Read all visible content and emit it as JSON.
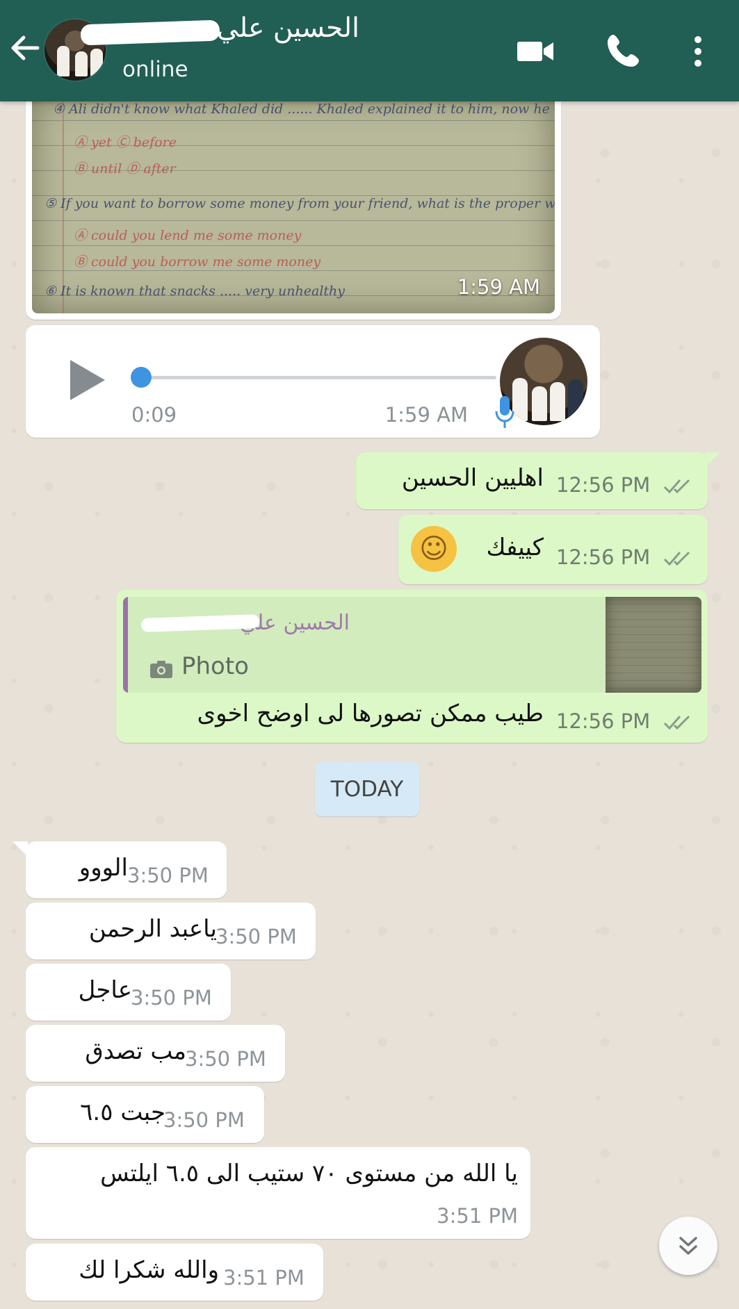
{
  "header": {
    "contact_name": "الحسين علي",
    "status": "online"
  },
  "messages": {
    "image": {
      "time": "1:59 AM"
    },
    "voice": {
      "duration": "0:09",
      "time": "1:59 AM"
    },
    "outgoing": [
      {
        "text": "اهليين الحسين",
        "time": "12:56 PM"
      },
      {
        "text": "كييفك",
        "emoji": "☺",
        "time": "12:56 PM"
      },
      {
        "quote_name": "الحسين علي",
        "quote_type": "Photo",
        "text": "طيب ممكن تصورها لى اوضح اخوى",
        "time": "12:56 PM"
      }
    ],
    "date_divider": "TODAY",
    "incoming": [
      {
        "text": "الووو",
        "time": "3:50 PM"
      },
      {
        "text": "ياعبد الرحمن",
        "time": "3:50 PM"
      },
      {
        "text": "عاجل",
        "time": "3:50 PM"
      },
      {
        "text": "مب تصدق",
        "time": "3:50 PM"
      },
      {
        "text": "جبت ٦.٥",
        "time": "3:50 PM"
      },
      {
        "text": "يا الله من مستوى ٧٠ ستيب الى ٦.٥ ايلتس",
        "time": "3:51 PM"
      },
      {
        "text": "والله شكرا لك",
        "time": "3:51 PM"
      }
    ]
  },
  "colors": {
    "header": "#215e54",
    "outgoing_bubble": "#dcf8c6",
    "incoming_bubble": "#ffffff",
    "read_ticks": "#8a9b8c",
    "voice_knob": "#3f94e1",
    "date_chip": "#d5eaf6"
  },
  "icons": [
    "back-arrow-icon",
    "video-call-icon",
    "phone-icon",
    "more-vert-icon",
    "play-icon",
    "mic-icon",
    "camera-icon",
    "double-check-icon",
    "scroll-down-icon"
  ]
}
